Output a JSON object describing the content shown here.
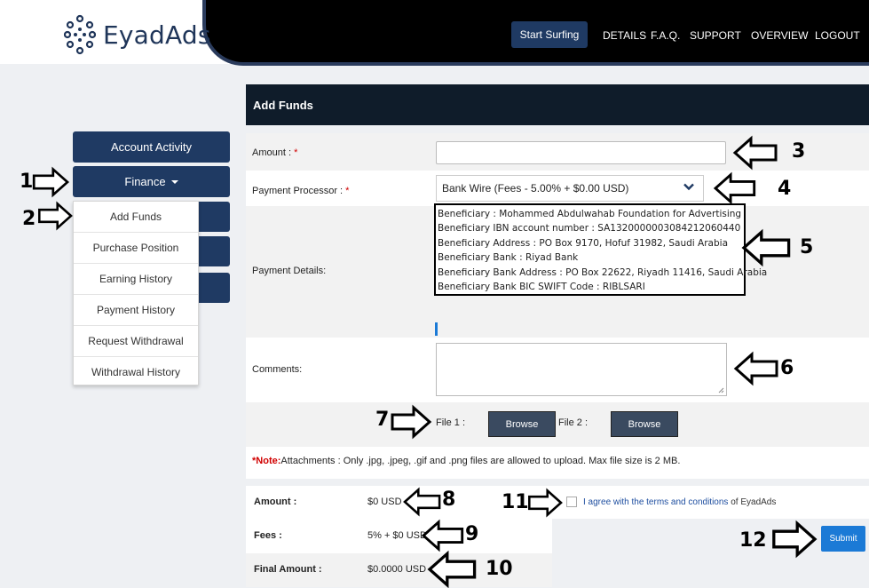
{
  "header": {
    "brand": "EyadAds",
    "start_button": "Start Surfing",
    "nav": [
      "DETAILS",
      "F.A.Q.",
      "SUPPORT",
      "OVERVIEW",
      "LOGOUT"
    ]
  },
  "sidebar": {
    "account_activity": "Account Activity",
    "finance": "Finance",
    "finance_menu": [
      "Add Funds",
      "Purchase Position",
      "Earning History",
      "Payment History",
      "Request Withdrawal",
      "Withdrawal History"
    ]
  },
  "form": {
    "title": "Add Funds",
    "amount_label": "Amount :",
    "amount_value": "",
    "processor_label": "Payment Processor :",
    "processor_value": "Bank Wire (Fees - 5.00% + $0.00 USD)",
    "details_label": "Payment Details:",
    "details_lines": [
      "Beneficiary : Mohammed Abdulwahab Foundation for Advertising",
      "Beneficiary IBN account number : SA1320000003084212060440",
      "Beneficiary Address : PO Box 9170, Hofuf 31982, Saudi Arabia",
      "Beneficiary Bank : Riyad Bank",
      "Beneficiary Bank Address : PO Box 22622, Riyadh 11416, Saudi Arabia",
      "Beneficiary Bank BIC SWIFT Code : RIBLSARI"
    ],
    "comments_label": "Comments:",
    "file1_label": "File 1 :",
    "file2_label": "File 2 :",
    "browse_label": "Browse",
    "note_prefix": "*Note:",
    "note_text": "Attachments : Only .jpg, .jpeg, .gif and .png files are allowed to upload. Max file size is 2 MB.",
    "required_mark": "*"
  },
  "summary": {
    "amount_label": "Amount :",
    "amount_value": "$0 USD",
    "fees_label": "Fees :",
    "fees_value": "5% + $0 USD",
    "final_label": "Final Amount :",
    "final_value": "$0.0000 USD"
  },
  "agreement": {
    "link_text": "I agree with the terms and conditions",
    "suffix": " of EyadAds",
    "checked": false
  },
  "submit_label": "Submit",
  "annotations": [
    "1",
    "2",
    "3",
    "4",
    "5",
    "6",
    "7",
    "8",
    "9",
    "10",
    "11",
    "12"
  ],
  "colors": {
    "navy": "#1f3a63",
    "panel_head": "#0f1c2a",
    "accent_blue": "#1b7ad6",
    "required_red": "#d00000"
  }
}
